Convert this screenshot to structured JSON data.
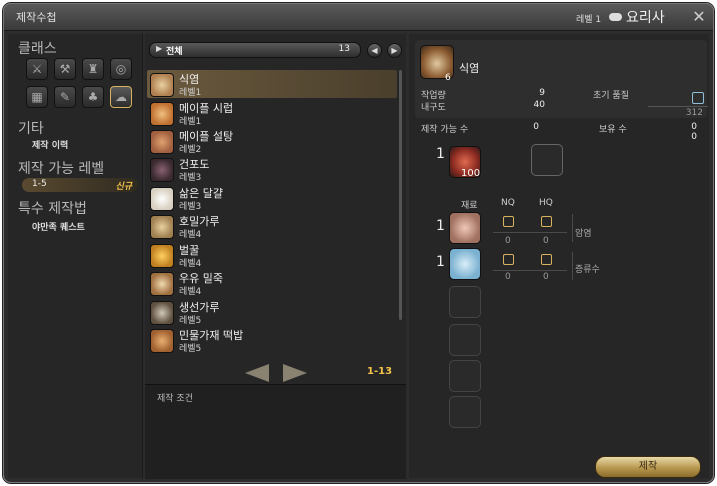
{
  "window": {
    "title": "제작수첩",
    "level_label": "레벨 1",
    "job": "요리사"
  },
  "left": {
    "class_title": "클래스",
    "class_icons": [
      "sword-icon",
      "anvil-icon",
      "helmet-icon",
      "ring-icon",
      "loom-icon",
      "quill-icon",
      "flask-icon",
      "pot-icon"
    ],
    "other_title": "기타",
    "other_items": [
      "제작 이력"
    ],
    "levels_title": "제작 가능 레벨",
    "level_range": "1-5",
    "level_new": "신규",
    "special_title": "특수 제작법",
    "special_items": [
      "야만족 퀘스트"
    ]
  },
  "list": {
    "filter_label": "전체",
    "filter_count": "13",
    "items": [
      {
        "name": "식염",
        "level": "레벨1",
        "color": "#b08050"
      },
      {
        "name": "메이플 시럽",
        "level": "레벨1",
        "color": "#c07030"
      },
      {
        "name": "메이플 설탕",
        "level": "레벨2",
        "color": "#a06040"
      },
      {
        "name": "건포도",
        "level": "레벨3",
        "color": "#5a3a40"
      },
      {
        "name": "삶은 달걀",
        "level": "레벨3",
        "color": "#e8e0d0"
      },
      {
        "name": "호밀가루",
        "level": "레벨4",
        "color": "#c8a870"
      },
      {
        "name": "벌꿀",
        "level": "레벨4",
        "color": "#e0a030"
      },
      {
        "name": "우유 밀죽",
        "level": "레벨4",
        "color": "#d0b090"
      },
      {
        "name": "생선가루",
        "level": "레벨5",
        "color": "#a09080"
      },
      {
        "name": "민물가재 떡밥",
        "level": "레벨5",
        "color": "#c08040"
      }
    ],
    "page": "1-13",
    "conditions_label": "제작 조건"
  },
  "detail": {
    "product_name": "식염",
    "product_count": "6",
    "workload_label": "작업량",
    "workload": "9",
    "durability_label": "내구도",
    "durability": "40",
    "quality_label": "초기 품질",
    "quality_max": "312",
    "craftable_label": "제작 가능 수",
    "craftable": "0",
    "owned_label": "보유 수",
    "owned": "0",
    "owned_hq": "0",
    "crystal_qty": "1",
    "crystal_count": "100",
    "mat_header": "재료",
    "nq_header": "NQ",
    "hq_header": "HQ",
    "materials": [
      {
        "qty": "1",
        "name": "암염",
        "nq": "0",
        "hq": "0",
        "color": "#e0b0a0"
      },
      {
        "qty": "1",
        "name": "증류수",
        "nq": "0",
        "hq": "0",
        "color": "#9ac8e0"
      }
    ],
    "craft_button": "제작"
  }
}
